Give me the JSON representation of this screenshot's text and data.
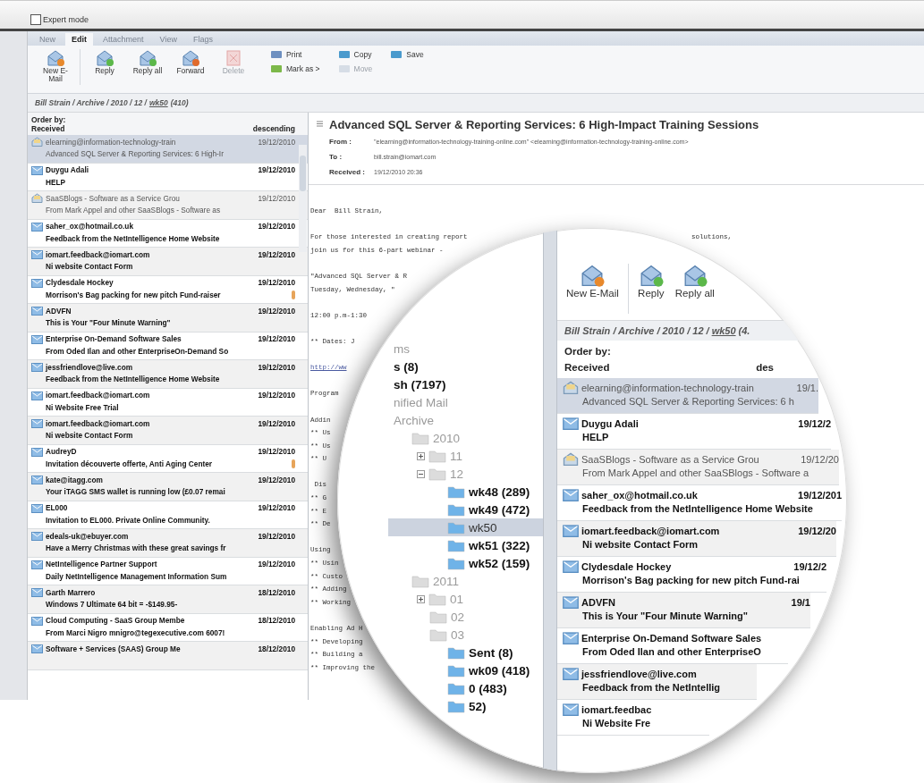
{
  "expert_mode": {
    "label": "Expert mode",
    "checked": false
  },
  "tabs": [
    {
      "label": "New",
      "selected": false
    },
    {
      "label": "Edit",
      "selected": true
    },
    {
      "label": "Attachment",
      "selected": false
    },
    {
      "label": "View",
      "selected": false
    },
    {
      "label": "Flags",
      "selected": false
    }
  ],
  "toolbar": {
    "large": [
      {
        "label": "New E-Mail",
        "disabled": false
      },
      {
        "label": "Reply",
        "disabled": false
      },
      {
        "label": "Reply all",
        "disabled": false
      },
      {
        "label": "Forward",
        "disabled": false
      },
      {
        "label": "Delete",
        "disabled": true
      }
    ],
    "small_columns": [
      [
        {
          "label": "Print",
          "disabled": false
        },
        {
          "label": "Mark as >",
          "disabled": false
        }
      ],
      [
        {
          "label": "Copy",
          "disabled": false
        },
        {
          "label": "Move",
          "disabled": true
        }
      ],
      [
        {
          "label": "Save",
          "disabled": false
        }
      ]
    ]
  },
  "breadcrumb": {
    "text": "Bill Strain / Archive / 2010 / 12 /",
    "link": "wk50",
    "count": "(410)"
  },
  "list": {
    "order_label": "Order by:",
    "sort_field": "Received",
    "sort_direction": "descending",
    "rows": [
      {
        "sender": "elearning@information-technology-train",
        "date": "19/12/2010",
        "subject": "Advanced SQL Server & Reporting Services: 6 High-Ir",
        "unread": false,
        "selected": true,
        "attachment": false
      },
      {
        "sender": "Duygu Adali",
        "date": "19/12/2010",
        "subject": "HELP",
        "unread": true,
        "selected": false,
        "attachment": false
      },
      {
        "sender": "SaaSBlogs - Software as a Service Grou",
        "date": "19/12/2010",
        "subject": "From Mark Appel and other SaaSBlogs - Software as",
        "unread": false,
        "selected": false,
        "attachment": false
      },
      {
        "sender": "saher_ox@hotmail.co.uk",
        "date": "19/12/2010",
        "subject": "Feedback from the NetIntelligence Home Website",
        "unread": true,
        "selected": false,
        "attachment": false
      },
      {
        "sender": "iomart.feedback@iomart.com",
        "date": "19/12/2010",
        "subject": "Ni website Contact Form",
        "unread": true,
        "selected": false,
        "attachment": false
      },
      {
        "sender": "Clydesdale Hockey",
        "date": "19/12/2010",
        "subject": "Morrison's Bag packing for new pitch Fund-raiser",
        "unread": true,
        "selected": false,
        "attachment": true
      },
      {
        "sender": "ADVFN",
        "date": "19/12/2010",
        "subject": "This is Your \"Four Minute Warning\"",
        "unread": true,
        "selected": false,
        "attachment": false
      },
      {
        "sender": "Enterprise On-Demand Software Sales",
        "date": "19/12/2010",
        "subject": "From Oded Ilan and other EnterpriseOn-Demand So",
        "unread": true,
        "selected": false,
        "attachment": false
      },
      {
        "sender": "jessfriendlove@live.com",
        "date": "19/12/2010",
        "subject": "Feedback from the NetIntelligence Home Website",
        "unread": true,
        "selected": false,
        "attachment": false
      },
      {
        "sender": "iomart.feedback@iomart.com",
        "date": "19/12/2010",
        "subject": "Ni Website Free Trial",
        "unread": true,
        "selected": false,
        "attachment": false
      },
      {
        "sender": "iomart.feedback@iomart.com",
        "date": "19/12/2010",
        "subject": "Ni website Contact Form",
        "unread": true,
        "selected": false,
        "attachment": false
      },
      {
        "sender": "AudreyD",
        "date": "19/12/2010",
        "subject": "Invitation découverte offerte, Anti Aging Center",
        "unread": true,
        "selected": false,
        "attachment": true
      },
      {
        "sender": "kate@itagg.com",
        "date": "19/12/2010",
        "subject": "Your iTAGG SMS wallet is running low (£0.07 remai",
        "unread": true,
        "selected": false,
        "attachment": false
      },
      {
        "sender": "EL000",
        "date": "19/12/2010",
        "subject": "Invitation to EL000. Private Online Community.",
        "unread": true,
        "selected": false,
        "attachment": false
      },
      {
        "sender": "edeals-uk@ebuyer.com",
        "date": "19/12/2010",
        "subject": "Have a Merry Christmas with these great savings fr",
        "unread": true,
        "selected": false,
        "attachment": false
      },
      {
        "sender": "NetIntelligence Partner Support",
        "date": "19/12/2010",
        "subject": "Daily NetIntelligence Management Information Sum",
        "unread": true,
        "selected": false,
        "attachment": false
      },
      {
        "sender": "Garth Marrero",
        "date": "18/12/2010",
        "subject": "Windows 7 Ultimate 64 bit = -$149.95-",
        "unread": true,
        "selected": false,
        "attachment": false
      },
      {
        "sender": "Cloud Computing - SaaS Group Membe",
        "date": "18/12/2010",
        "subject": "From Marci Nigro mnigro@tegexecutive.com 6007!",
        "unread": true,
        "selected": false,
        "attachment": false
      },
      {
        "sender": "Software + Services (SAAS) Group Me",
        "date": "18/12/2010",
        "unread": true,
        "selected": false
      }
    ]
  },
  "message": {
    "subject": "Advanced SQL Server & Reporting Services: 6 High-Impact Training Sessions",
    "fields": [
      {
        "label": "From :",
        "value": "\"elearning@information-technology-training-online.com\" <elearning@information-technology-training-online.com>"
      },
      {
        "label": "To :",
        "value": "bill.strain@iomart.com"
      },
      {
        "label": "Received :",
        "value": "19/12/2010 20:36"
      }
    ],
    "paragraphs": [
      [
        {
          "kind": "text",
          "parts": [
            "Dear  Bill Strain,"
          ]
        }
      ],
      [
        {
          "kind": "text",
          "parts": [
            "For those interested in creating report",
            "solutions,"
          ]
        },
        {
          "kind": "text",
          "parts": [
            "join us for this 6-part webinar -"
          ]
        }
      ],
      [
        {
          "kind": "text",
          "parts": [
            "\"Advanced SQL Server & R"
          ]
        },
        {
          "kind": "text",
          "parts": [
            "Tuesday, Wednesday, \""
          ]
        }
      ],
      [
        {
          "kind": "text",
          "parts": [
            "12:00 p.m-1:30"
          ]
        }
      ],
      [
        {
          "kind": "text",
          "parts": [
            "** Dates: J"
          ]
        }
      ],
      [
        {
          "kind": "link",
          "parts": [
            "http://ww"
          ]
        }
      ],
      [
        {
          "kind": "text",
          "parts": [
            "Program"
          ]
        }
      ],
      [
        {
          "kind": "text",
          "parts": [
            "Addin"
          ]
        },
        {
          "kind": "text",
          "parts": [
            "** Us"
          ]
        },
        {
          "kind": "text",
          "parts": [
            "** Us"
          ]
        },
        {
          "kind": "text",
          "parts": [
            "** U"
          ]
        }
      ],
      [
        {
          "kind": "text",
          "parts": [
            " Dis"
          ]
        },
        {
          "kind": "text",
          "parts": [
            "** G"
          ]
        },
        {
          "kind": "text",
          "parts": [
            "** E"
          ]
        },
        {
          "kind": "text",
          "parts": [
            "** De"
          ]
        }
      ],
      [
        {
          "kind": "text",
          "parts": [
            "Using"
          ]
        },
        {
          "kind": "text",
          "parts": [
            "** Usin"
          ]
        },
        {
          "kind": "text",
          "parts": [
            "** Custo"
          ]
        },
        {
          "kind": "text",
          "parts": [
            "** Adding"
          ]
        },
        {
          "kind": "text",
          "parts": [
            "** Working"
          ]
        }
      ],
      [
        {
          "kind": "text",
          "parts": [
            "Enabling Ad H"
          ]
        },
        {
          "kind": "text",
          "parts": [
            "** Developing"
          ]
        },
        {
          "kind": "text",
          "parts": [
            "** Building a"
          ]
        },
        {
          "kind": "text",
          "parts": [
            "** Improving the"
          ]
        }
      ]
    ]
  },
  "magnifier": {
    "tree": [
      {
        "label": "ms",
        "bold": false,
        "selected": false
      },
      {
        "label": "s (8)",
        "bold": true,
        "selected": false
      },
      {
        "label": "sh (7197)",
        "bold": true,
        "selected": false
      },
      {
        "label": "nified Mail",
        "bold": false,
        "selected": false
      },
      {
        "label": "Archive",
        "bold": false,
        "selected": false,
        "children": [
          {
            "label": "2010",
            "bold": false,
            "selected": false,
            "children": [
              {
                "label": "11",
                "bold": false,
                "selected": false,
                "expanded": false
              },
              {
                "label": "12",
                "bold": false,
                "selected": false,
                "expanded": true,
                "children": [
                  {
                    "label": "wk48 (289)",
                    "bold": true,
                    "selected": false
                  },
                  {
                    "label": "wk49 (472)",
                    "bold": true,
                    "selected": false
                  },
                  {
                    "label": "wk50",
                    "bold": false,
                    "selected": true
                  },
                  {
                    "label": "wk51 (322)",
                    "bold": true,
                    "selected": false
                  },
                  {
                    "label": "wk52 (159)",
                    "bold": true,
                    "selected": false
                  }
                ]
              }
            ]
          },
          {
            "label": "2011",
            "bold": false,
            "selected": false,
            "children": [
              {
                "label": "01",
                "bold": false,
                "selected": false,
                "expanded": false
              },
              {
                "label": "02",
                "bold": false,
                "selected": false
              },
              {
                "label": "03",
                "bold": false,
                "selected": false,
                "children": [
                  {
                    "label": "Sent (8)",
                    "bold": true,
                    "selected": false
                  },
                  {
                    "label": "wk09 (418)",
                    "bold": true,
                    "selected": false
                  },
                  {
                    "label": "0 (483)",
                    "bold": true,
                    "selected": false
                  },
                  {
                    "label": "52)",
                    "bold": true,
                    "selected": false
                  }
                ]
              }
            ]
          }
        ]
      }
    ],
    "toolbar": [
      {
        "label": "New E-Mail"
      },
      {
        "label": "Reply"
      },
      {
        "label": "Reply all"
      }
    ],
    "breadcrumb": {
      "text": "Bill Strain / Archive / 2010 / 12 /",
      "link": "wk50",
      "count": "(4."
    },
    "order_label": "Order by:",
    "sort_field": "Received",
    "sort_direction": "des",
    "rows": [
      {
        "sender": "elearning@information-technology-train",
        "date": "19/1.",
        "subject": "Advanced SQL Server & Reporting Services: 6 h",
        "unread": false,
        "selected": true
      },
      {
        "sender": "Duygu Adali",
        "date": "19/12/2",
        "subject": "HELP",
        "unread": true,
        "selected": false
      },
      {
        "sender": "SaaSBlogs - Software as a Service Grou",
        "date": "19/12/20",
        "subject": "From Mark Appel and other SaaSBlogs - Software a",
        "unread": false,
        "selected": false
      },
      {
        "sender": "saher_ox@hotmail.co.uk",
        "date": "19/12/201",
        "subject": "Feedback from the NetIntelligence Home Website",
        "unread": true,
        "selected": false
      },
      {
        "sender": "iomart.feedback@iomart.com",
        "date": "19/12/20",
        "subject": "Ni website Contact Form",
        "unread": true,
        "selected": false
      },
      {
        "sender": "Clydesdale Hockey",
        "date": "19/12/2",
        "subject": "Morrison's Bag packing for new pitch Fund-rai",
        "unread": true,
        "selected": false
      },
      {
        "sender": "ADVFN",
        "date": "19/1",
        "subject": "This is Your \"Four Minute Warning\"",
        "unread": true,
        "selected": false
      },
      {
        "sender": "Enterprise On-Demand Software Sales",
        "subject": "From Oded Ilan and other EnterpriseO",
        "unread": true,
        "selected": false
      },
      {
        "sender": "jessfriendlove@live.com",
        "subject": "Feedback from the NetIntellig",
        "unread": true,
        "selected": false
      },
      {
        "sender": "iomart.feedbac",
        "subject": "Ni Website Fre",
        "unread": true,
        "selected": false
      }
    ]
  }
}
